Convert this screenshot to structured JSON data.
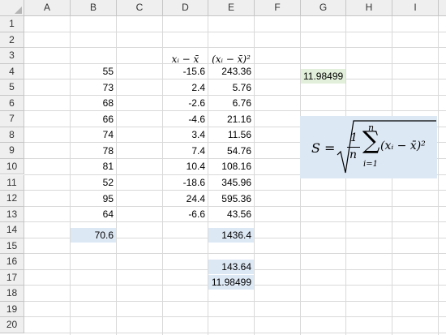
{
  "columns": [
    "A",
    "B",
    "C",
    "D",
    "E",
    "F",
    "G",
    "H",
    "I"
  ],
  "rows": [
    "1",
    "2",
    "3",
    "4",
    "5",
    "6",
    "7",
    "8",
    "9",
    "10",
    "11",
    "12",
    "13",
    "14",
    "15",
    "16",
    "17",
    "18",
    "19",
    "20"
  ],
  "headers": {
    "d3": "xᵢ − x̄",
    "e3": "(xᵢ − x̄)²"
  },
  "col_b": [
    "55",
    "73",
    "68",
    "66",
    "74",
    "78",
    "81",
    "52",
    "95",
    "64"
  ],
  "col_d": [
    "-15.6",
    "2.4",
    "-2.6",
    "-4.6",
    "3.4",
    "7.4",
    "10.4",
    "-18.6",
    "24.4",
    "-6.6"
  ],
  "col_e": [
    "243.36",
    "5.76",
    "6.76",
    "21.16",
    "11.56",
    "54.76",
    "108.16",
    "345.96",
    "595.36",
    "43.56"
  ],
  "b14": "70.6",
  "e14": "1436.4",
  "e16": "143.64",
  "e17": "11.98499",
  "g4": "11.98499",
  "formula": {
    "lhs": "S =",
    "one": "1",
    "n_denominator": "n",
    "sum_top": "n",
    "sum_bottom": "i=1",
    "sigma": "∑",
    "term": "(xᵢ − x̄)²"
  },
  "colors": {
    "highlight_blue": "#dde8f5",
    "highlight_green": "#e2efda"
  }
}
